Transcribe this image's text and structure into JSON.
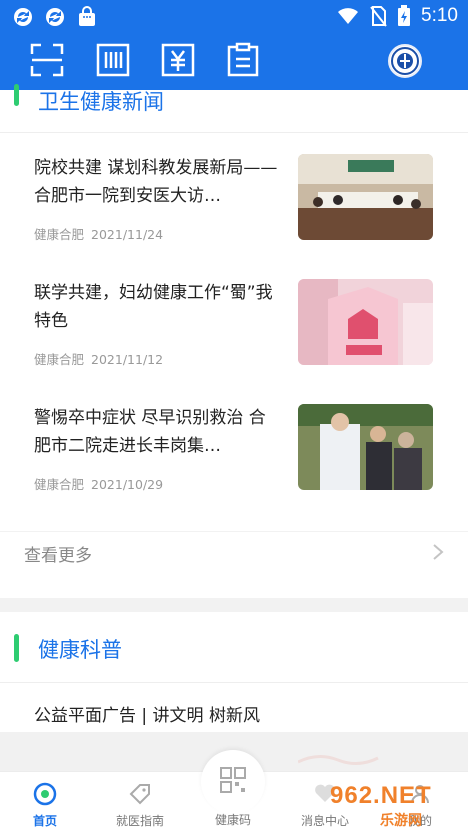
{
  "status_bar": {
    "time": "5:10"
  },
  "toolbar": {
    "icons": [
      "scan-icon",
      "barcode-icon",
      "yuan-payment-icon",
      "clipboard-icon",
      "hospital-emblem-icon"
    ]
  },
  "news_section": {
    "title": "卫生健康新闻",
    "items": [
      {
        "title": "院校共建 谋划科教发展新局——合肥市一院到安医大访…",
        "source": "健康合肥",
        "date": "2021/11/24"
      },
      {
        "title": "联学共建，妇幼健康工作“蜀”我特色",
        "source": "健康合肥",
        "date": "2021/11/12"
      },
      {
        "title": "警惕卒中症状 尽早识别救治 合肥市二院走进长丰岗集…",
        "source": "健康合肥",
        "date": "2021/10/29"
      }
    ],
    "more_label": "查看更多"
  },
  "science_section": {
    "title": "健康科普",
    "items": [
      {
        "title": "公益平面广告 | 讲文明 树新风"
      }
    ]
  },
  "bottom_nav": {
    "items": [
      {
        "label": "首页",
        "icon": "home-icon"
      },
      {
        "label": "就医指南",
        "icon": "guide-tag-icon"
      },
      {
        "label": "健康码",
        "icon": "qr-code-icon"
      },
      {
        "label": "消息中心",
        "icon": "message-icon"
      },
      {
        "label": "我的",
        "icon": "profile-icon"
      }
    ]
  },
  "watermark": {
    "text": "962.NET",
    "subtext": "乐游网"
  },
  "colors": {
    "primary": "#1b73e8",
    "accent": "#2ecc71",
    "text": "#222222",
    "muted": "#999999"
  }
}
